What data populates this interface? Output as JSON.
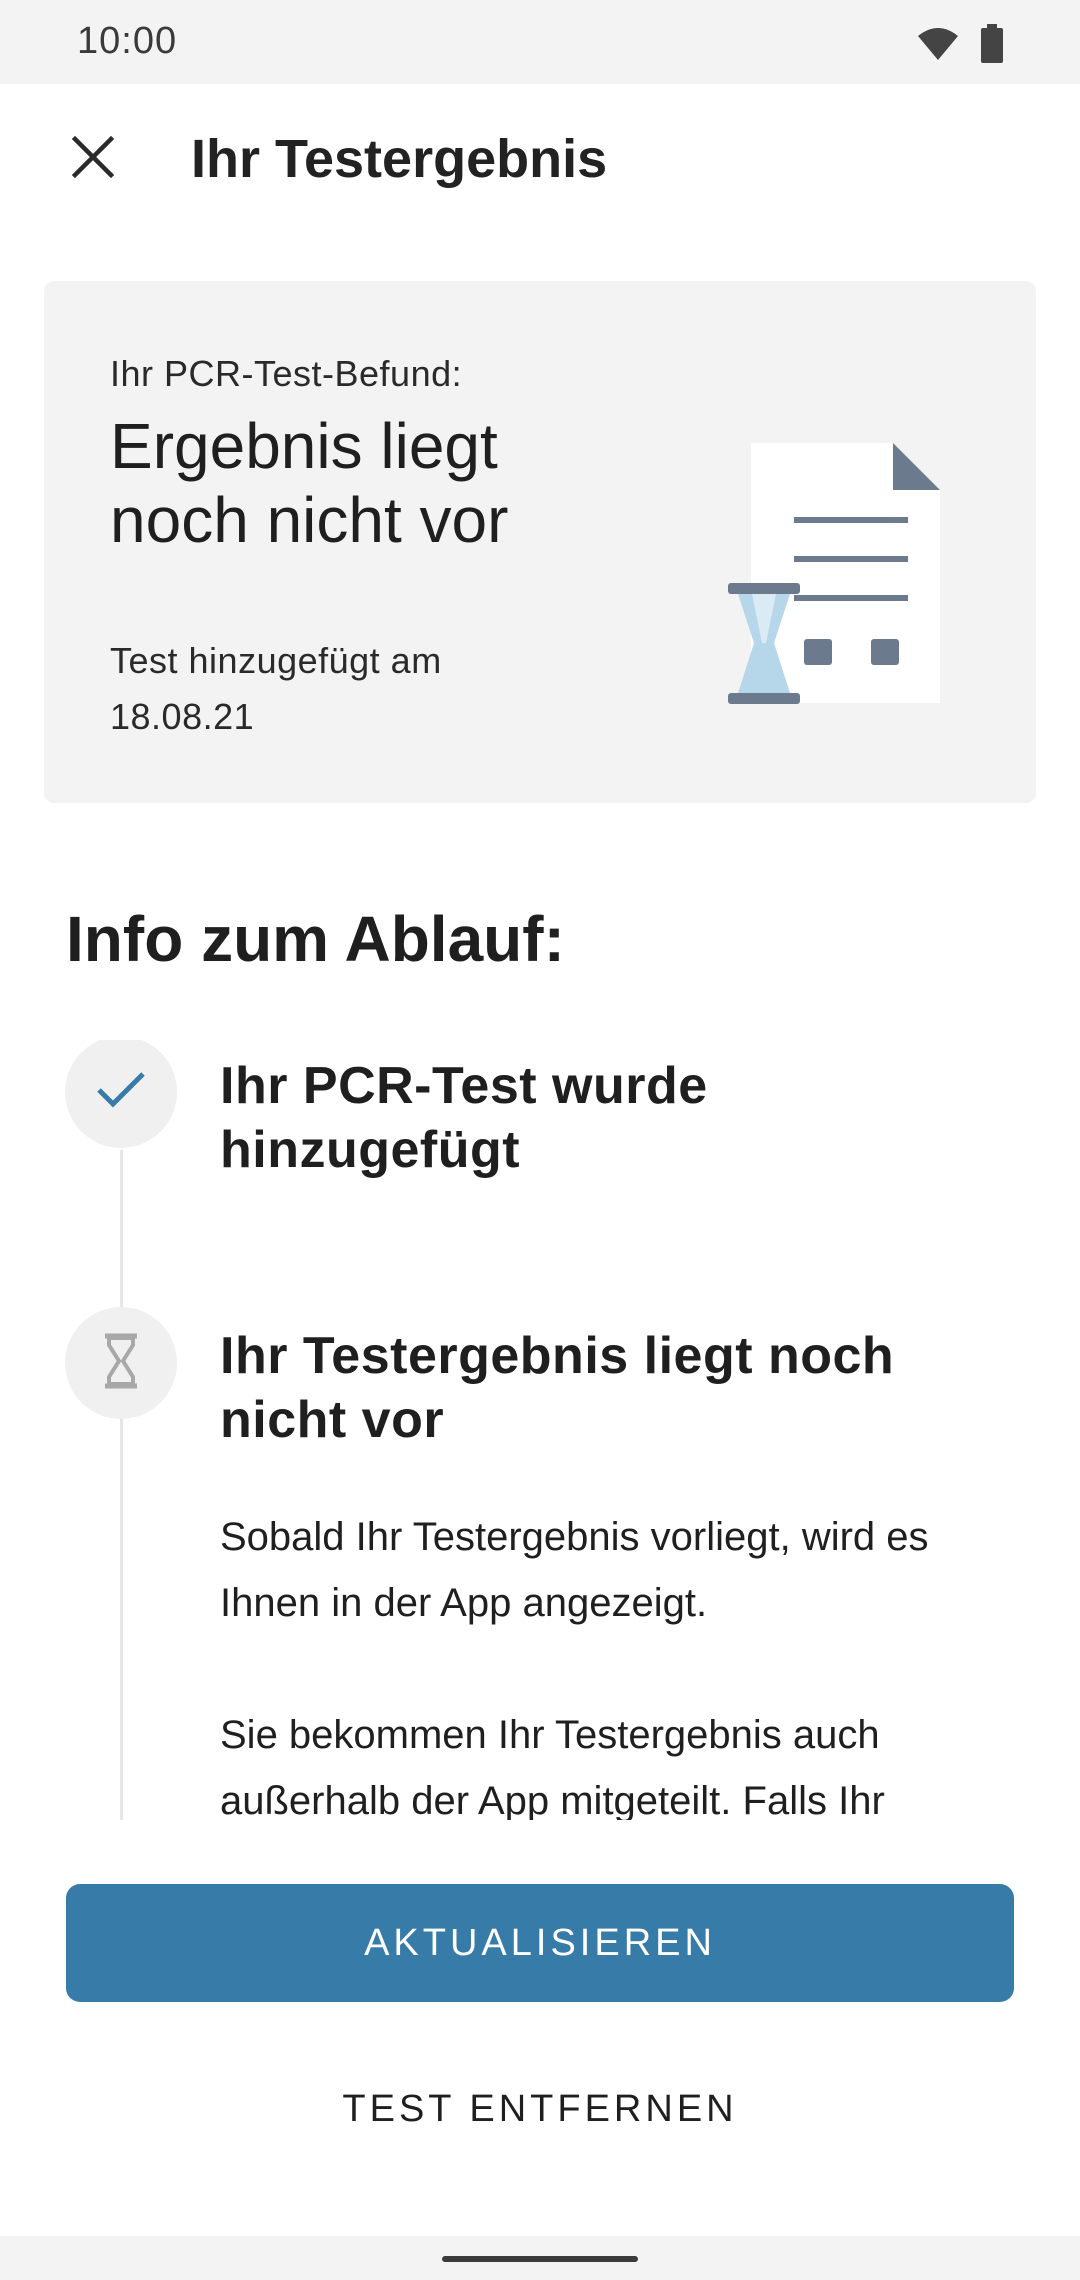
{
  "status_bar": {
    "time": "10:00",
    "icons": [
      "wifi-icon",
      "battery-icon"
    ]
  },
  "app_bar": {
    "close_icon": "close-icon",
    "title": "Ihr Testergebnis"
  },
  "result_card": {
    "label": "Ihr PCR-Test-Befund:",
    "result": "Ergebnis liegt noch nicht vor",
    "date_text": "Test hinzugefügt am 18.08.21",
    "illustration": "document-hourglass-illustration"
  },
  "info": {
    "heading": "Info zum Ablauf:",
    "steps": [
      {
        "icon": "check-icon",
        "title": "Ihr PCR-Test wurde hinzugefügt"
      },
      {
        "icon": "hourglass-icon",
        "title": "Ihr Testergebnis liegt noch nicht vor",
        "body": [
          "Sobald Ihr Testergebnis vorliegt, wird es Ihnen in der App angezeigt.",
          "Sie bekommen Ihr Testergebnis auch außerhalb der App mitgeteilt. Falls Ihr"
        ]
      }
    ]
  },
  "actions": {
    "refresh_label": "AKTUALISIEREN",
    "remove_label": "TEST ENTFERNEN"
  },
  "colors": {
    "primary": "#377ca8",
    "card_background": "#f3f3f3",
    "icon_slate": "#6b7a8c",
    "hourglass_sand": "#b6d6ea"
  }
}
